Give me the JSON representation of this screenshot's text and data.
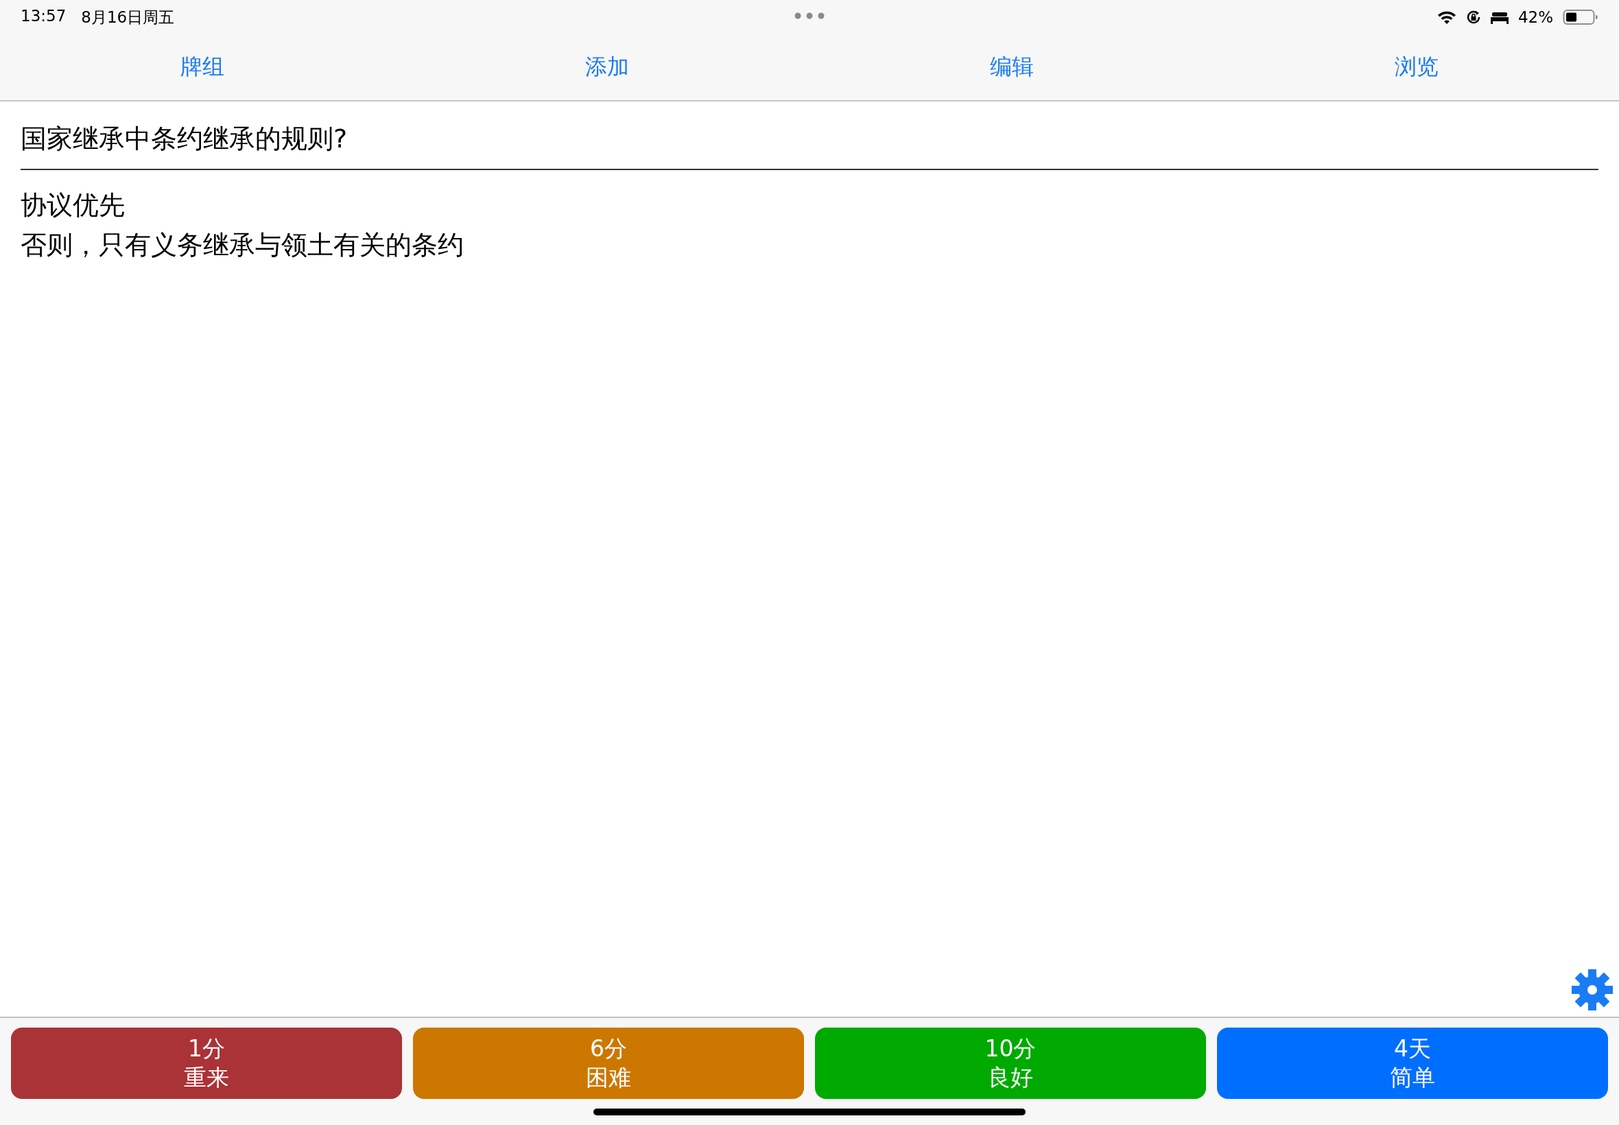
{
  "status_bar": {
    "time": "13:57",
    "date": "8月16日周五",
    "battery_percent": "42%"
  },
  "tabs": [
    {
      "label": "牌组"
    },
    {
      "label": "添加"
    },
    {
      "label": "编辑"
    },
    {
      "label": "浏览"
    }
  ],
  "card": {
    "question": "国家继承中条约继承的规则?",
    "answer_lines": [
      "协议优先",
      "否则，只有义务继承与领土有关的条约"
    ]
  },
  "answer_buttons": [
    {
      "interval": "1分",
      "label": "重来",
      "color": "#a93336"
    },
    {
      "interval": "6分",
      "label": "困难",
      "color": "#cc7700"
    },
    {
      "interval": "10分",
      "label": "良好",
      "color": "#00aa00"
    },
    {
      "interval": "4天",
      "label": "简单",
      "color": "#006eff"
    }
  ]
}
